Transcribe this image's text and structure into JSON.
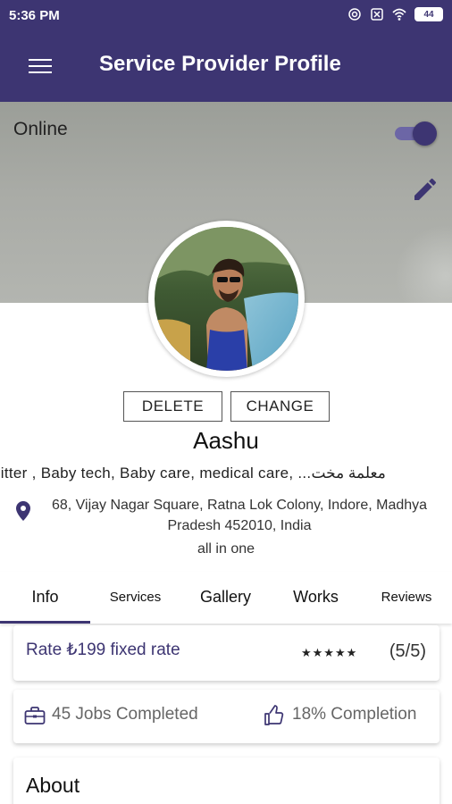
{
  "status_bar": {
    "time": "5:36 PM",
    "battery": "44",
    "icons": [
      "target-icon",
      "sim-off-icon",
      "wifi-icon",
      "battery-icon"
    ]
  },
  "app_bar": {
    "title": "Service Provider Profile",
    "menu_icon": "hamburger-menu-icon",
    "color": "#3d3572"
  },
  "cover": {
    "online_label": "Online",
    "online_enabled": true,
    "edit_icon": "pencil-icon"
  },
  "profile": {
    "delete_label": "DELETE",
    "change_label": "CHANGE",
    "name": "Aashu",
    "categories": "sitter , Baby tech, Baby care, medical care, ...معلمة مخت",
    "address": "68, Vijay Nagar Square, Ratna Lok Colony, Indore, Madhya Pradesh 452010, India",
    "tagline": "all in one"
  },
  "tabs": [
    {
      "label": "Info",
      "active": true
    },
    {
      "label": "Services",
      "active": false
    },
    {
      "label": "Gallery",
      "active": false
    },
    {
      "label": "Works",
      "active": false
    },
    {
      "label": "Reviews",
      "active": false
    }
  ],
  "rate_card": {
    "rate_text": "Rate ₺199 fixed rate",
    "stars": "★★★★★",
    "rating": 5,
    "score": "(5/5)"
  },
  "stats_card": {
    "jobs_text": "45 Jobs Completed",
    "completion_text": "18% Completion"
  },
  "about_card": {
    "title": "About"
  }
}
